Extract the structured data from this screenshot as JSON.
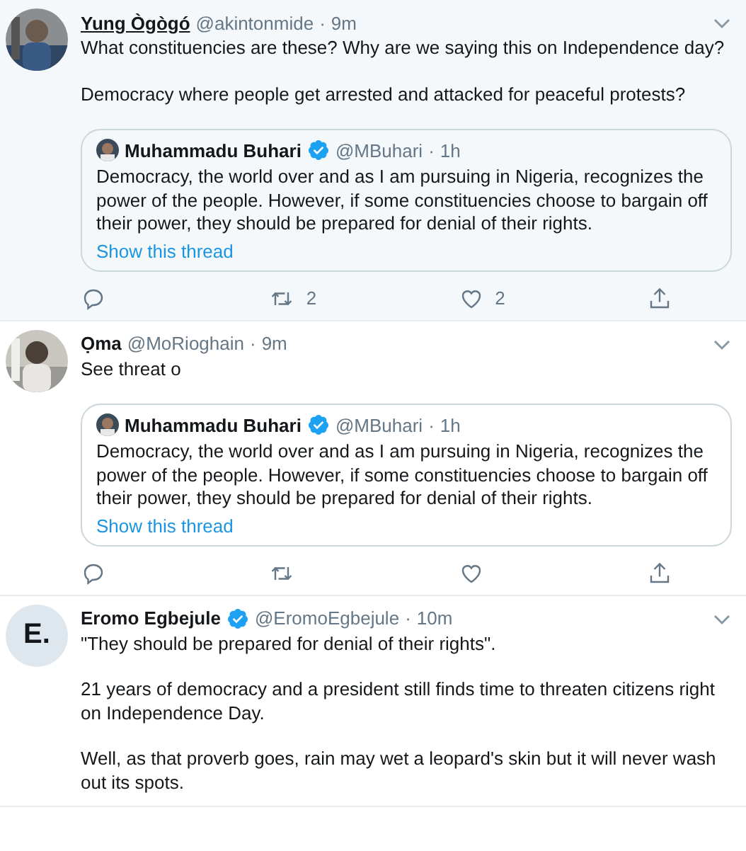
{
  "tweets": [
    {
      "name": "Yung Ògògó",
      "handle": "@akintonmide",
      "separator": "·",
      "time": "9m",
      "verified": false,
      "hovered": true,
      "avatar": {
        "kind": "picture"
      },
      "paragraphs": [
        "What constituencies are these? Why are we saying this on Independence day?",
        "Democracy where people get arrested and attacked for peaceful protests?"
      ],
      "quote": {
        "name": "Muhammadu Buhari",
        "handle": "@MBuhari",
        "separator": "·",
        "time": "1h",
        "verified": true,
        "text": "Democracy, the world over and as I am pursuing in Nigeria, recognizes the power of the people. However, if some constituencies choose to bargain off their power, they should be prepared for denial of their rights.",
        "link": "Show this thread"
      },
      "actions": [
        {
          "kind": "reply"
        },
        {
          "kind": "retweet",
          "count": "2"
        },
        {
          "kind": "like",
          "count": "2"
        },
        {
          "kind": "share"
        }
      ]
    },
    {
      "name": "Ọma",
      "handle": "@MoRioghain",
      "separator": "·",
      "time": "9m",
      "verified": false,
      "hovered": false,
      "avatar": {
        "kind": "picture"
      },
      "paragraphs": [
        "See threat o"
      ],
      "quote": {
        "name": "Muhammadu Buhari",
        "handle": "@MBuhari",
        "separator": "·",
        "time": "1h",
        "verified": true,
        "text": "Democracy, the world over and as I am pursuing in Nigeria, recognizes the power of the people. However, if some constituencies choose to bargain off their power, they should be prepared for denial of their rights.",
        "link": "Show this thread"
      },
      "actions": [
        {
          "kind": "reply"
        },
        {
          "kind": "retweet"
        },
        {
          "kind": "like"
        },
        {
          "kind": "share"
        }
      ]
    },
    {
      "name": "Eromo Egbejule",
      "handle": "@EromoEgbejule",
      "separator": "·",
      "time": "10m",
      "verified": true,
      "hovered": false,
      "avatar": {
        "kind": "initial",
        "text": "E."
      },
      "paragraphs": [
        "\"They should be prepared for denial of their rights\".",
        "21 years of democracy and a president still finds time to threaten citizens right on Independence Day.",
        "Well, as that proverb goes, rain may wet a leopard's skin but it will never wash out its spots."
      ]
    }
  ]
}
